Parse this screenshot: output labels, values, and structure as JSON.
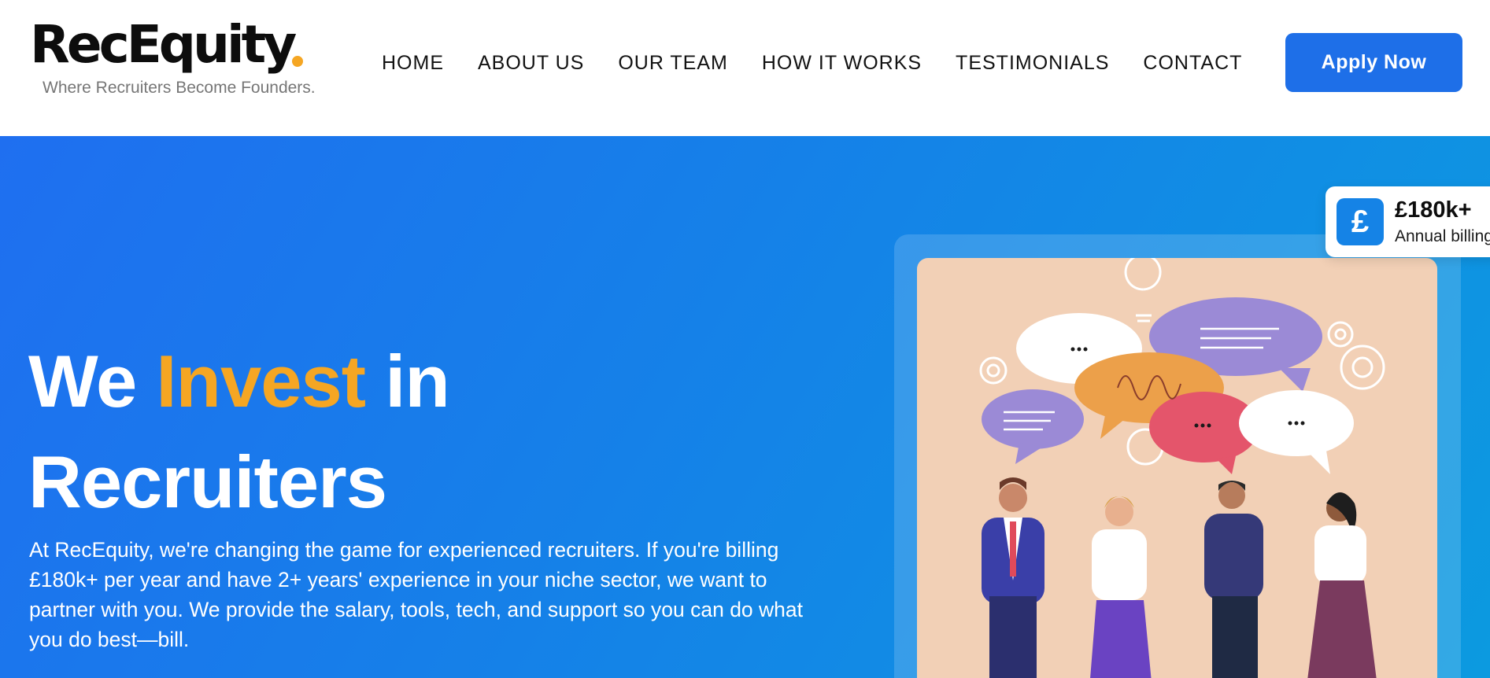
{
  "brand": {
    "name": "RecEquity",
    "tagline": "Where Recruiters Become Founders.",
    "dot_color": "#f5a623"
  },
  "nav": {
    "items": [
      {
        "label": "HOME"
      },
      {
        "label": "ABOUT US"
      },
      {
        "label": "OUR TEAM"
      },
      {
        "label": "HOW IT WORKS"
      },
      {
        "label": "TESTIMONIALS"
      },
      {
        "label": "CONTACT"
      }
    ],
    "cta_label": "Apply Now",
    "cta_color": "#1e6fe8"
  },
  "hero": {
    "title_part1": "We ",
    "title_highlight": "Invest",
    "title_part2": " in",
    "title_line2": "Recruiters",
    "highlight_color": "#f5a623",
    "description": "At RecEquity, we're changing the game for experienced recruiters. If you're billing £180k+ per year and have 2+ years' experience in your niche sector, we want to partner with you. We provide the salary, tools, tech, and support so you can do what you do best—bill.",
    "gradient_start": "#1f6ff0",
    "gradient_end": "#0c9ae0"
  },
  "stat_card": {
    "icon": "pound-icon",
    "icon_glyph": "£",
    "value": "£180k+",
    "label": "Annual billing",
    "icon_color": "#1583e6"
  },
  "illustration": {
    "subject": "team-conversation-illustration",
    "background_color": "#f2d0b6"
  }
}
